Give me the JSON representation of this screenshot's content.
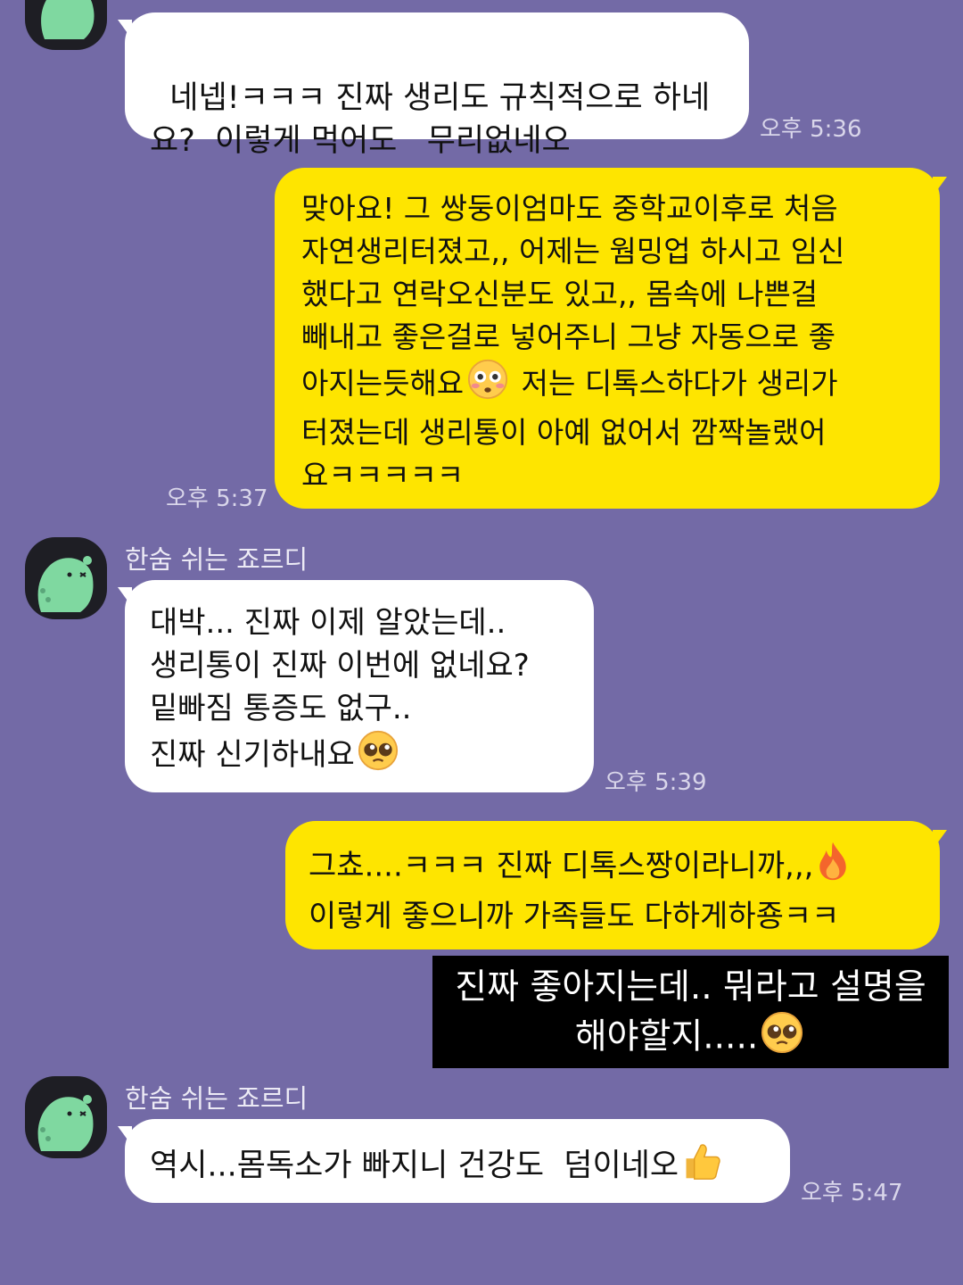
{
  "colors": {
    "background": "#736aa6",
    "incoming_bubble": "#ffffff",
    "outgoing_bubble": "#fee500",
    "caption_bg": "#000000",
    "avatar_bg": "#1e1e24",
    "avatar_character": "#7fd8a0"
  },
  "chat": {
    "messages": [
      {
        "id": "m1",
        "direction": "incoming",
        "text_before": "네넵!ㅋㅋㅋ 진짜 생리도 규칙적으로 하네\n요?  이렇게 먹어도   무리없네오",
        "emoji_icon": "",
        "text_after": "",
        "time": "오후 5:36"
      },
      {
        "id": "m2",
        "direction": "outgoing",
        "text_before": "맞아요! 그 쌍둥이엄마도 중학교이후로 처음\n자연생리터졌고,, 어제는 웜밍업 하시고 임신\n했다고 연락오신분도 있고,, 몸속에 나쁜걸\n빼내고 좋은걸로 넣어주니 그냥 자동으로 좋\n아지는듯해요",
        "emoji_icon": "flushed-face-icon",
        "text_after": " 저는 디톡스하다가 생리가\n터졌는데 생리통이 아예 없어서 깜짝놀랬어\n요ㅋㅋㅋㅋㅋ",
        "time": "오후 5:37"
      },
      {
        "id": "m3",
        "direction": "incoming",
        "sender": "한숨 쉬는 죠르디",
        "text_before": "대박... 진짜 이제 알았는데..\n생리통이 진짜 이번에 없네요?\n밑빠짐 통증도 없구..\n진짜 신기하내요",
        "emoji_icon": "pleading-face-icon",
        "text_after": "",
        "time": "오후 5:39"
      },
      {
        "id": "m4",
        "direction": "outgoing",
        "text_before": "그쵸....ㅋㅋㅋ 진짜 디톡스짱이라니까,,,",
        "emoji_icon": "fire-icon",
        "text_after": "\n이렇게 좋으니까 가족들도 다하게하죵ㅋㅋ",
        "time": ""
      },
      {
        "id": "m5",
        "direction": "incoming",
        "sender": "한숨 쉬는 죠르디",
        "text_before": "역시...몸독소가 빠지니 건강도  덤이네오",
        "emoji_icon": "thumbs-up-icon",
        "text_after": "",
        "time": "오후 5:47"
      }
    ]
  },
  "caption": {
    "text_before": "진짜 좋아지는데.. 뭐라고 설명을\n해야할지.....",
    "emoji_icon": "pleading-face-icon"
  }
}
